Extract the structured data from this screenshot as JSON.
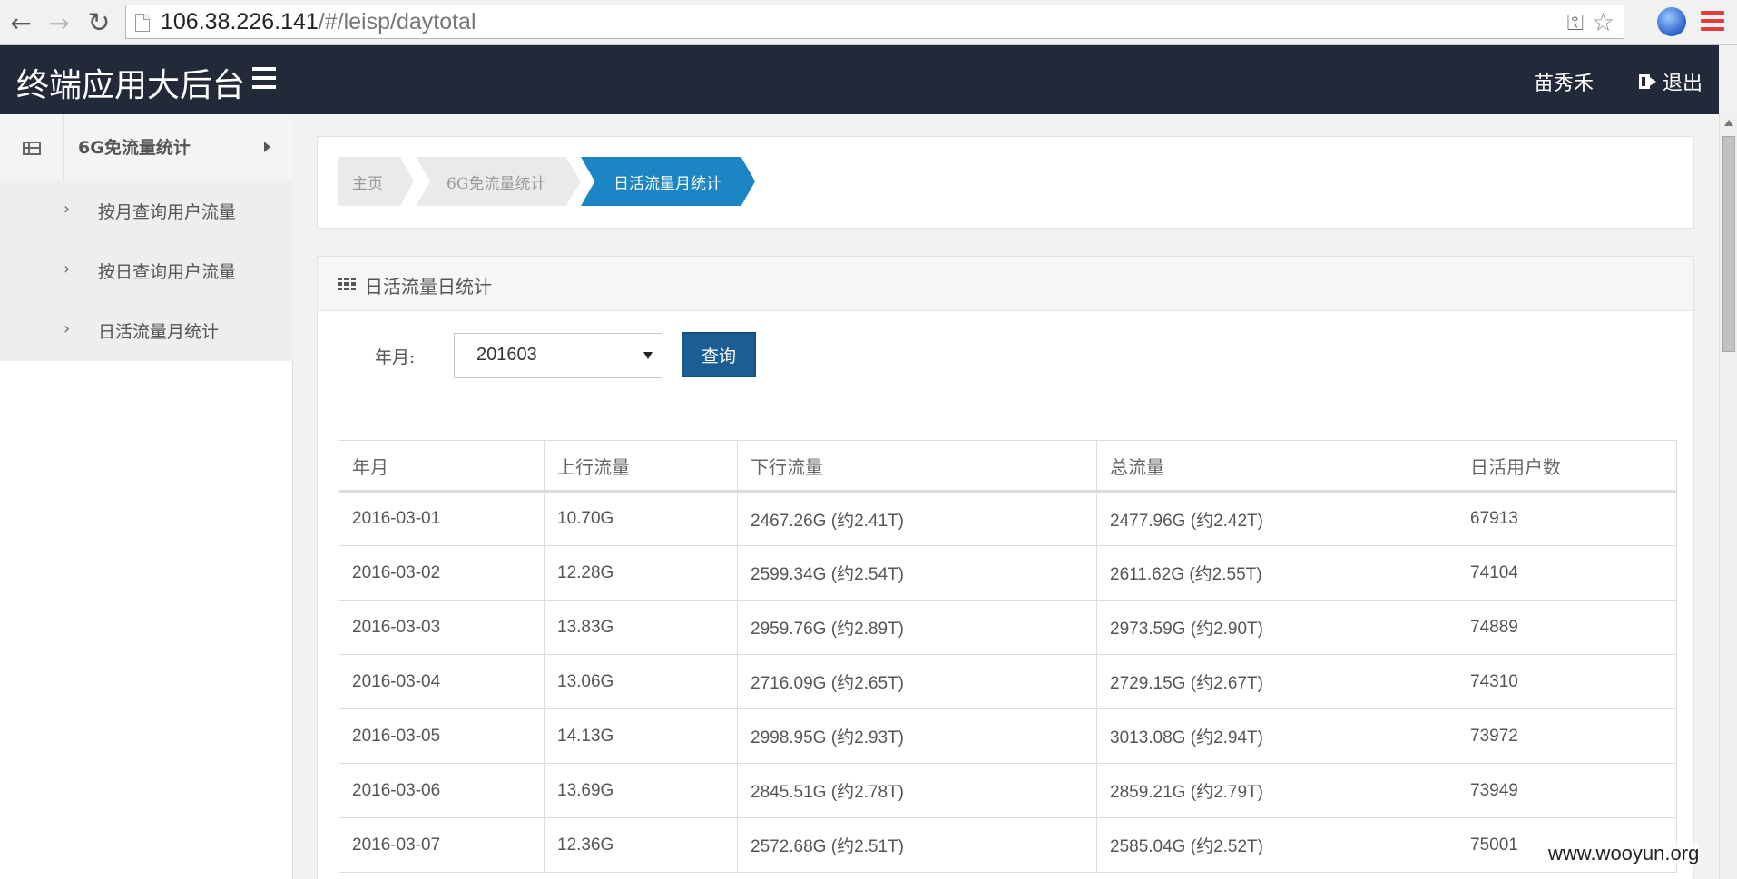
{
  "browser": {
    "url_host": "106.38.226.141",
    "url_path": "/#/leisp/daytotal"
  },
  "header": {
    "app_title": "终端应用大后台",
    "user_name": "苗秀禾",
    "logout_label": "退出",
    "background": "#222a3a"
  },
  "sidebar": {
    "group_label": "6G免流量统计",
    "items": [
      {
        "label": "按月查询用户流量"
      },
      {
        "label": "按日查询用户流量"
      },
      {
        "label": "日活流量月统计"
      }
    ]
  },
  "breadcrumb": {
    "items": [
      "主页",
      "6G免流量统计",
      "日活流量月统计"
    ],
    "active_color": "#1c85c4"
  },
  "panel": {
    "title": "日活流量日统计"
  },
  "form": {
    "label": "年月:",
    "select_value": "201603",
    "query_button": "查询"
  },
  "table": {
    "columns": [
      "年月",
      "上行流量",
      "下行流量",
      "总流量",
      "日活用户数"
    ],
    "rows": [
      [
        "2016-03-01",
        "10.70G",
        "2467.26G (约2.41T)",
        "2477.96G (约2.42T)",
        "67913"
      ],
      [
        "2016-03-02",
        "12.28G",
        "2599.34G (约2.54T)",
        "2611.62G (约2.55T)",
        "74104"
      ],
      [
        "2016-03-03",
        "13.83G",
        "2959.76G (约2.89T)",
        "2973.59G (约2.90T)",
        "74889"
      ],
      [
        "2016-03-04",
        "13.06G",
        "2716.09G (约2.65T)",
        "2729.15G (约2.67T)",
        "74310"
      ],
      [
        "2016-03-05",
        "14.13G",
        "2998.95G (约2.93T)",
        "3013.08G (约2.94T)",
        "73972"
      ],
      [
        "2016-03-06",
        "13.69G",
        "2845.51G (约2.78T)",
        "2859.21G (约2.79T)",
        "73949"
      ],
      [
        "2016-03-07",
        "12.36G",
        "2572.68G (约2.51T)",
        "2585.04G (约2.52T)",
        "75001"
      ]
    ]
  },
  "watermark": "www.wooyun.org"
}
